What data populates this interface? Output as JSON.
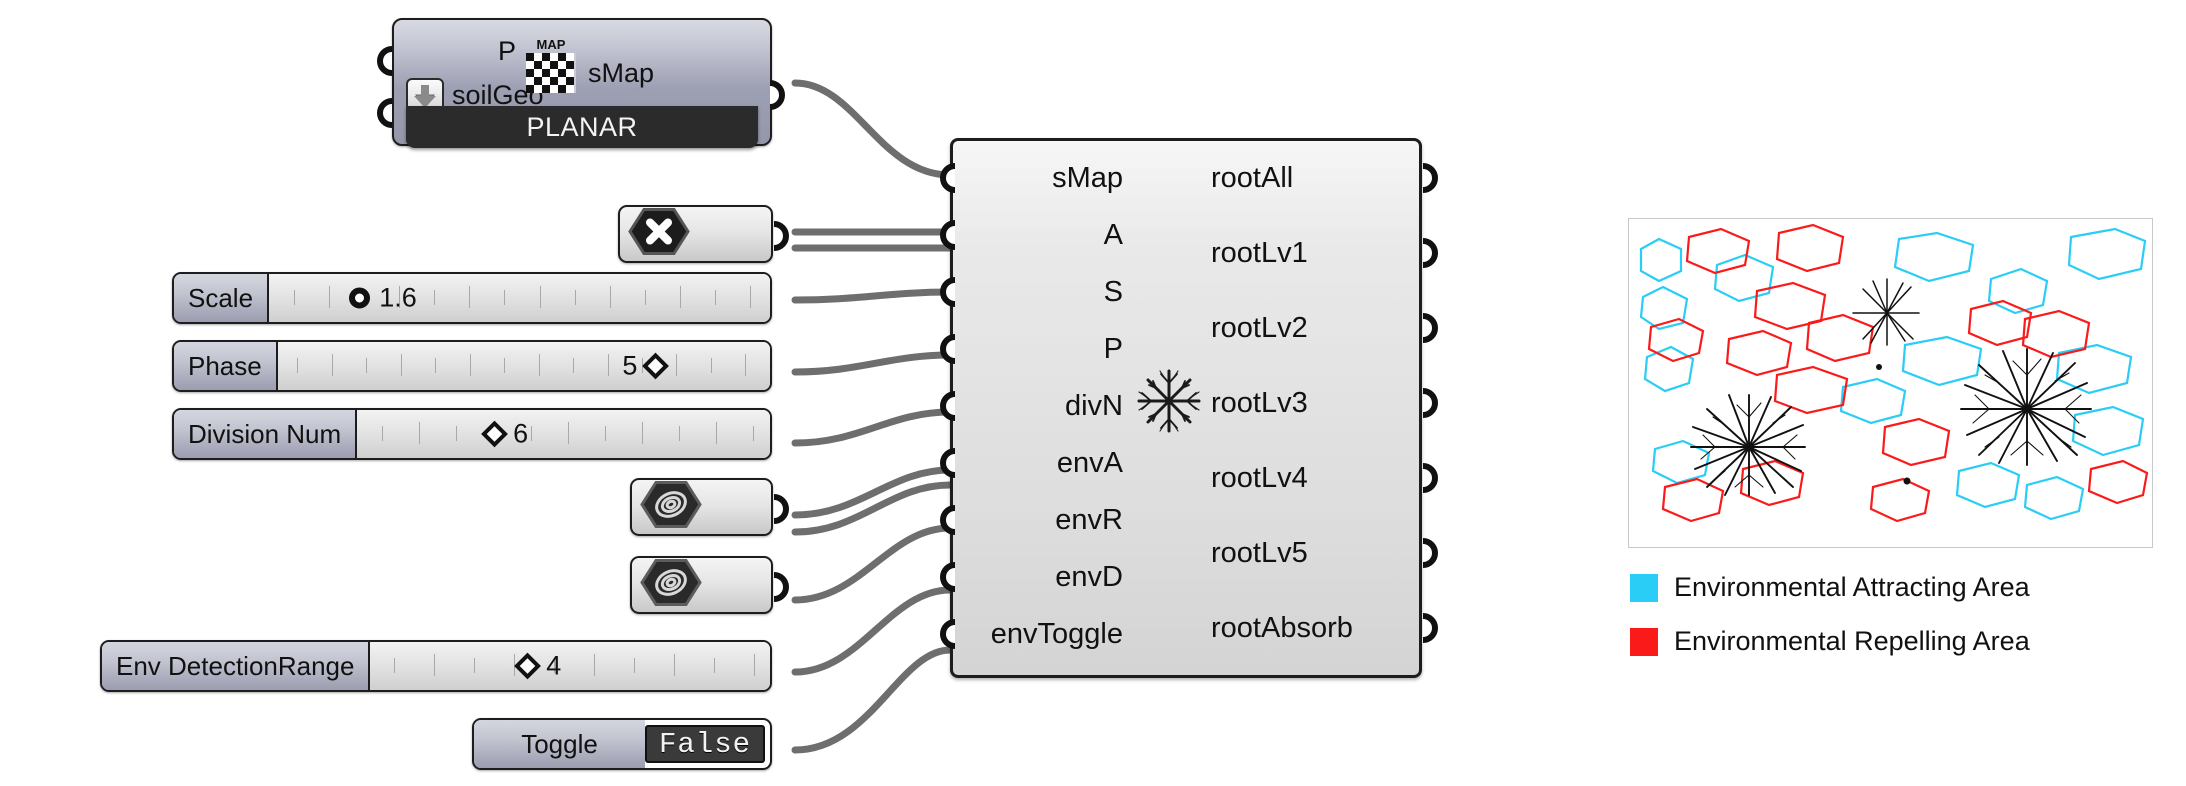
{
  "planar_node": {
    "title": "PLANAR",
    "input_labels": [
      "P",
      "soilGeo"
    ],
    "output_label": "sMap",
    "map_icon": "map-grid-icon",
    "download_icon": "download-arrow-icon"
  },
  "params": [
    {
      "kind": "icon",
      "name": "geometry-param-x",
      "icon": "hex-x-icon"
    },
    {
      "kind": "slider",
      "name": "Scale",
      "value": "1.6",
      "knob": "circle",
      "knob_pct": 19
    },
    {
      "kind": "slider",
      "name": "Phase",
      "value": "5",
      "knob": "diamond",
      "knob_pct": 79,
      "value_before_knob": true
    },
    {
      "kind": "slider",
      "name": "Division Num",
      "value": "6",
      "knob": "diamond",
      "knob_pct": 36
    },
    {
      "kind": "icon",
      "name": "geometry-param-curve-a",
      "icon": "hex-curve-icon"
    },
    {
      "kind": "icon",
      "name": "geometry-param-curve-b",
      "icon": "hex-curve-icon"
    },
    {
      "kind": "slider",
      "name": "Env DetectionRange",
      "value": "4",
      "knob": "diamond",
      "knob_pct": 43
    },
    {
      "kind": "toggle",
      "name": "Toggle",
      "value": "False"
    }
  ],
  "main_component": {
    "icon": "root-fractal-icon",
    "inputs": [
      "sMap",
      "A",
      "S",
      "P",
      "divN",
      "envA",
      "envR",
      "envD",
      "envToggle"
    ],
    "outputs": [
      "rootAll",
      "rootLv1",
      "rootLv2",
      "rootLv3",
      "rootLv4",
      "rootLv5",
      "rootAbsorb"
    ]
  },
  "preview": {
    "name": "root-growth-preview",
    "attract_color": "#29CDF5",
    "repel_color": "#FB1A1A",
    "root_color": "#111111"
  },
  "legend": [
    {
      "color": "#29CDF5",
      "label": "Environmental Attracting Area"
    },
    {
      "color": "#FB1A1A",
      "label": "Environmental Repelling Area"
    }
  ]
}
